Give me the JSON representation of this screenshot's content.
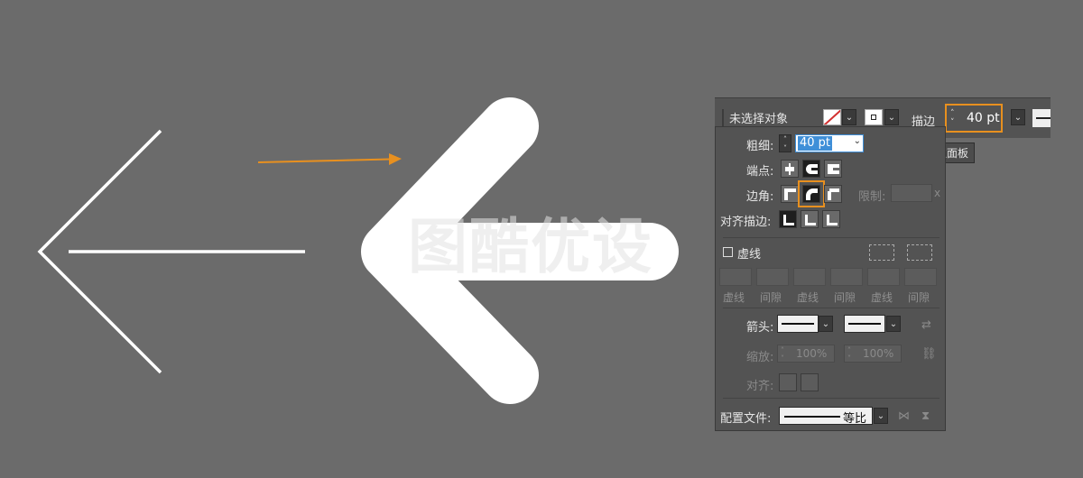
{
  "watermark": "图酷优设",
  "control_bar": {
    "selection_status": "未选择对象",
    "stroke_label": "描边",
    "stroke_value": "40 pt",
    "tooltip": "描边面板"
  },
  "stroke_panel": {
    "weight_label": "粗细:",
    "weight_value": "40 pt",
    "cap_label": "端点:",
    "corner_label": "边角:",
    "limit_label": "限制:",
    "limit_suffix": "x",
    "align_label": "对齐描边:",
    "dashed_label": "虚线",
    "dash_fields": [
      "虚线",
      "间隙",
      "虚线",
      "间隙",
      "虚线",
      "间隙"
    ],
    "arrowheads_label": "箭头:",
    "scale_label": "缩放:",
    "scale_values": [
      "100%",
      "100%"
    ],
    "align_arrow_label": "对齐:",
    "profile_label": "配置文件:",
    "profile_value": "等比"
  },
  "colors": {
    "artboard": "#6b6b6b",
    "panel": "#535353",
    "accent_highlight": "#e8901f",
    "selection_blue": "#3f8fd8"
  }
}
